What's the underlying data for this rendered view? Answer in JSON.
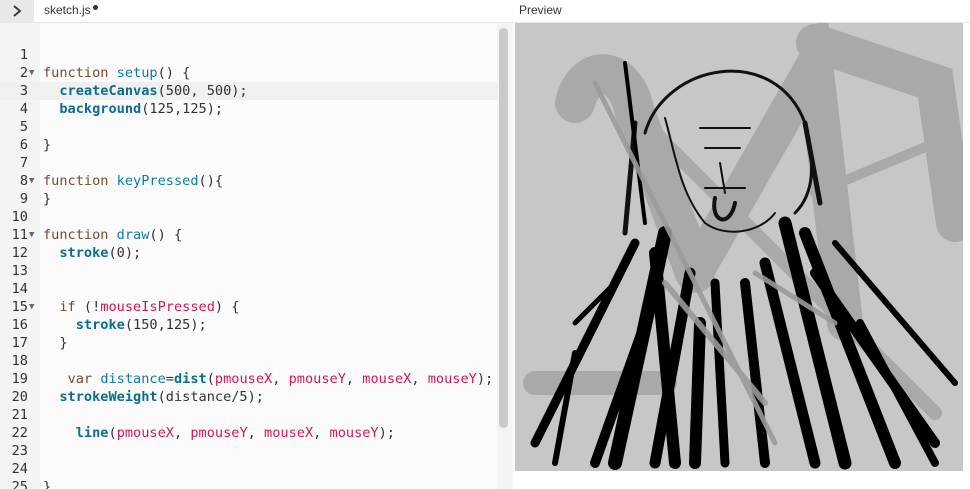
{
  "editor": {
    "filename": "sketch.js",
    "unsaved": true
  },
  "preview": {
    "label": "Preview"
  },
  "code": {
    "lines": [
      {
        "n": "1",
        "fold": false,
        "tokens": []
      },
      {
        "n": "2",
        "fold": true,
        "tokens": [
          {
            "t": "function ",
            "c": "kw"
          },
          {
            "t": "setup",
            "c": "fn"
          },
          {
            "t": "() {",
            "c": ""
          }
        ]
      },
      {
        "n": "3",
        "fold": false,
        "active": true,
        "tokens": [
          {
            "t": "  ",
            "c": ""
          },
          {
            "t": "createCanvas",
            "c": "bold"
          },
          {
            "t": "(500, 500);",
            "c": ""
          }
        ]
      },
      {
        "n": "4",
        "fold": false,
        "tokens": [
          {
            "t": "  ",
            "c": ""
          },
          {
            "t": "background",
            "c": "bold"
          },
          {
            "t": "(125,125);",
            "c": ""
          }
        ]
      },
      {
        "n": "5",
        "fold": false,
        "tokens": []
      },
      {
        "n": "6",
        "fold": false,
        "tokens": [
          {
            "t": "}",
            "c": ""
          }
        ]
      },
      {
        "n": "7",
        "fold": false,
        "tokens": []
      },
      {
        "n": "8",
        "fold": true,
        "tokens": [
          {
            "t": "function ",
            "c": "kw"
          },
          {
            "t": "keyPressed",
            "c": "fn"
          },
          {
            "t": "(){",
            "c": ""
          }
        ]
      },
      {
        "n": "9",
        "fold": false,
        "tokens": [
          {
            "t": "}",
            "c": ""
          }
        ]
      },
      {
        "n": "10",
        "fold": false,
        "tokens": []
      },
      {
        "n": "11",
        "fold": true,
        "tokens": [
          {
            "t": "function ",
            "c": "kw"
          },
          {
            "t": "draw",
            "c": "fn"
          },
          {
            "t": "() {",
            "c": ""
          }
        ]
      },
      {
        "n": "12",
        "fold": false,
        "tokens": [
          {
            "t": "  ",
            "c": ""
          },
          {
            "t": "stroke",
            "c": "bold"
          },
          {
            "t": "(0);",
            "c": ""
          }
        ]
      },
      {
        "n": "13",
        "fold": false,
        "tokens": []
      },
      {
        "n": "14",
        "fold": false,
        "tokens": []
      },
      {
        "n": "15",
        "fold": true,
        "tokens": [
          {
            "t": "  ",
            "c": ""
          },
          {
            "t": "if",
            "c": "kw"
          },
          {
            "t": " (!",
            "c": ""
          },
          {
            "t": "mouseIsPressed",
            "c": "var"
          },
          {
            "t": ") {",
            "c": ""
          }
        ]
      },
      {
        "n": "16",
        "fold": false,
        "tokens": [
          {
            "t": "    ",
            "c": ""
          },
          {
            "t": "stroke",
            "c": "bold"
          },
          {
            "t": "(150,125);",
            "c": ""
          }
        ]
      },
      {
        "n": "17",
        "fold": false,
        "tokens": [
          {
            "t": "  }",
            "c": ""
          }
        ]
      },
      {
        "n": "18",
        "fold": false,
        "tokens": []
      },
      {
        "n": "19",
        "fold": false,
        "tokens": [
          {
            "t": "   ",
            "c": ""
          },
          {
            "t": "var",
            "c": "kw"
          },
          {
            "t": " ",
            "c": ""
          },
          {
            "t": "distance",
            "c": "fn"
          },
          {
            "t": "=",
            "c": ""
          },
          {
            "t": "dist",
            "c": "bold"
          },
          {
            "t": "(",
            "c": ""
          },
          {
            "t": "pmouseX",
            "c": "var"
          },
          {
            "t": ", ",
            "c": ""
          },
          {
            "t": "pmouseY",
            "c": "var"
          },
          {
            "t": ", ",
            "c": ""
          },
          {
            "t": "mouseX",
            "c": "var"
          },
          {
            "t": ", ",
            "c": ""
          },
          {
            "t": "mouseY",
            "c": "var"
          },
          {
            "t": ");",
            "c": ""
          }
        ]
      },
      {
        "n": "20",
        "fold": false,
        "tokens": [
          {
            "t": "  ",
            "c": ""
          },
          {
            "t": "strokeWeight",
            "c": "bold"
          },
          {
            "t": "(distance/5);",
            "c": ""
          }
        ]
      },
      {
        "n": "21",
        "fold": false,
        "tokens": []
      },
      {
        "n": "22",
        "fold": false,
        "tokens": [
          {
            "t": "    ",
            "c": ""
          },
          {
            "t": "line",
            "c": "bold"
          },
          {
            "t": "(",
            "c": ""
          },
          {
            "t": "pmouseX",
            "c": "var"
          },
          {
            "t": ", ",
            "c": ""
          },
          {
            "t": "pmouseY",
            "c": "var"
          },
          {
            "t": ", ",
            "c": ""
          },
          {
            "t": "mouseX",
            "c": "var"
          },
          {
            "t": ", ",
            "c": ""
          },
          {
            "t": "mouseY",
            "c": "var"
          },
          {
            "t": ");",
            "c": ""
          }
        ]
      },
      {
        "n": "23",
        "fold": false,
        "tokens": []
      },
      {
        "n": "24",
        "fold": false,
        "tokens": []
      },
      {
        "n": "25",
        "fold": false,
        "tokens": [
          {
            "t": "}",
            "c": ""
          }
        ]
      }
    ]
  },
  "colors": {
    "canvas_background": "#7d7d7d",
    "keyword": "#7a4a2e",
    "function": "#0b7ca9",
    "variable": "#d4145a"
  }
}
